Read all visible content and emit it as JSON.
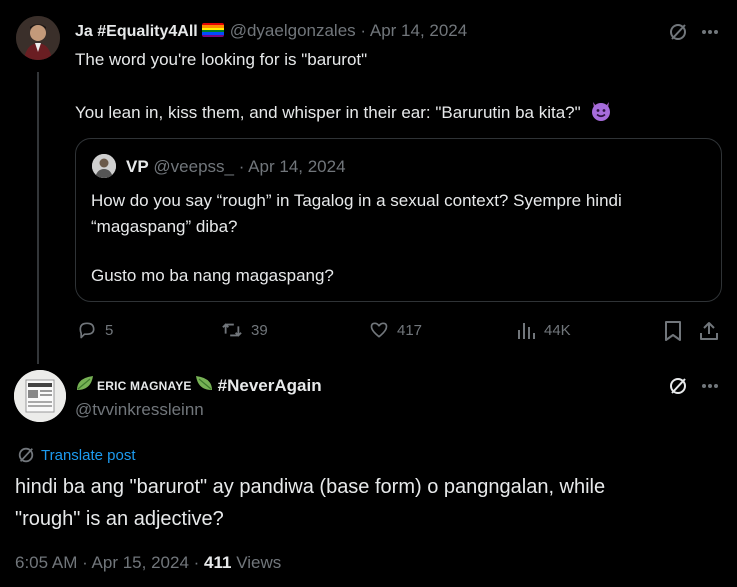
{
  "post": {
    "author_name": "Ja #Equality4All",
    "author_handle": "@dyaelgonzales",
    "date": "· Apr 14, 2024",
    "line1": "The word you're looking for is \"barurot\"",
    "line2": "You lean in, kiss them, and whisper in their ear: \"Barurutin ba kita?\"",
    "emoji_icon": "smiling-devil-icon",
    "quote": {
      "author_name": "VP",
      "author_handle": "@veepss_",
      "date": "· Apr 14, 2024",
      "line1": "How do you say “rough” in Tagalog in a sexual context? Syempre hindi",
      "line2": "“magaspang” diba?",
      "line3": "Gusto mo ba nang magaspang?"
    },
    "actions": {
      "replies": "5",
      "reposts": "39",
      "likes": "417",
      "views": "44K"
    }
  },
  "reply": {
    "author_name_prefix": "ERIC MAGNAYE",
    "author_name_hashtag": "#NeverAgain",
    "author_handle": "@tvvinkressleinn",
    "avatar_text": "SAVE EVERY",
    "translate_label": "Translate post",
    "line1": "hindi ba ang \"barurot\" ay pandiwa (base form) o pangngalan, while",
    "line2": "\"rough\" is an adjective?",
    "timestamp": "6:05 AM · Apr 15, 2024 ·",
    "views_count": "411",
    "views_label": "Views"
  },
  "colors": {
    "background": "#000000",
    "text": "#e7e9ea",
    "muted": "#71767b",
    "border": "#2f3336",
    "link": "#1d9bf0"
  }
}
